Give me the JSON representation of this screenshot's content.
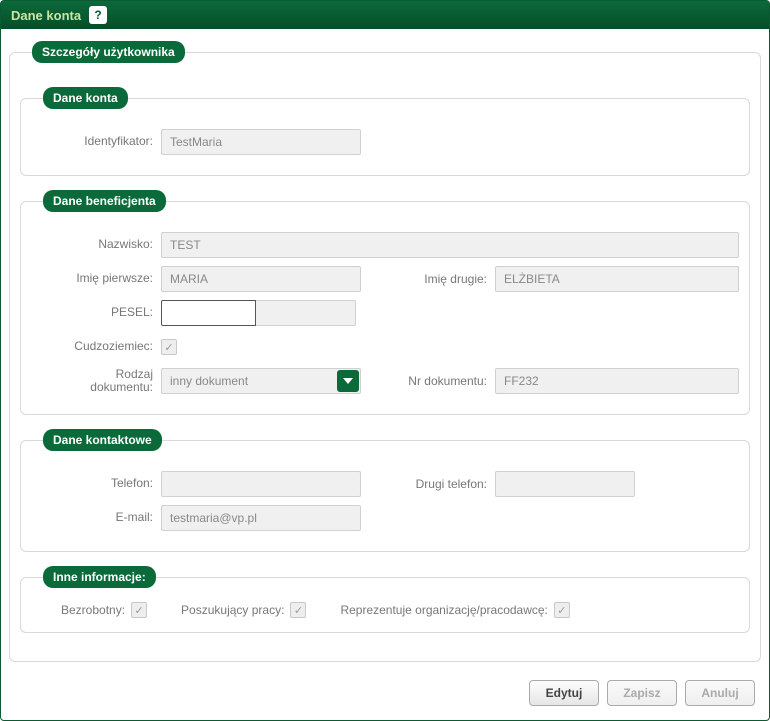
{
  "titlebar": {
    "title": "Dane konta",
    "help_icon": "?"
  },
  "outer": {
    "legend": "Szczegóły użytkownika"
  },
  "account": {
    "legend": "Dane konta",
    "identyfikator_label": "Identyfikator:",
    "identyfikator": "TestMaria"
  },
  "beneficiary": {
    "legend": "Dane beneficjenta",
    "nazwisko_label": "Nazwisko:",
    "nazwisko": "TEST",
    "imie_pierwsze_label": "Imię pierwsze:",
    "imie_pierwsze": "MARIA",
    "imie_drugie_label": "Imię drugie:",
    "imie_drugie": "ELŻBIETA",
    "pesel_label": "PESEL:",
    "pesel_part1": "",
    "pesel_part2": "",
    "cudzoziemiec_label": "Cudzoziemiec:",
    "cudzoziemiec_checked": true,
    "rodzaj_dok_label": "Rodzaj dokumentu:",
    "rodzaj_dok": "inny dokument",
    "nr_dok_label": "Nr dokumentu:",
    "nr_dok": "FF232"
  },
  "contact": {
    "legend": "Dane kontaktowe",
    "telefon_label": "Telefon:",
    "telefon": "",
    "drugi_telefon_label": "Drugi telefon:",
    "drugi_telefon": "",
    "email_label": "E-mail:",
    "email": "testmaria@vp.pl"
  },
  "other": {
    "legend": "Inne informacje:",
    "bezrobotny_label": "Bezrobotny:",
    "bezrobotny_checked": true,
    "poszukujacy_label": "Poszukujący pracy:",
    "poszukujacy_checked": true,
    "reprezentuje_label": "Reprezentuje organizację/pracodawcę:",
    "reprezentuje_checked": true
  },
  "buttons": {
    "edytuj": "Edytuj",
    "zapisz": "Zapisz",
    "anuluj": "Anuluj"
  }
}
